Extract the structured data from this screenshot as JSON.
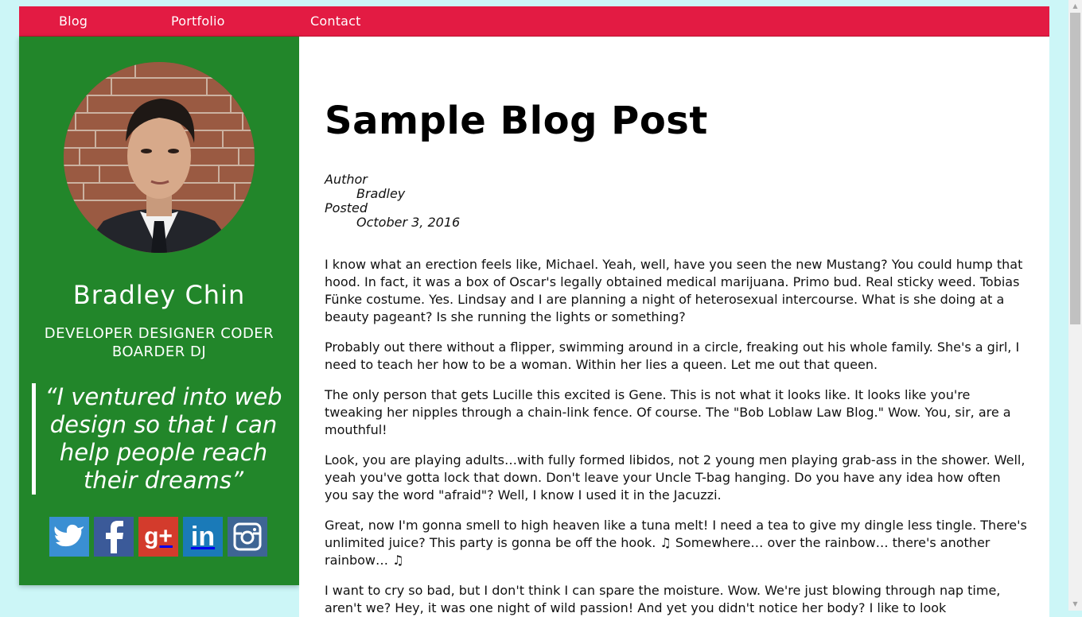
{
  "nav": {
    "items": [
      "Blog",
      "Portfolio",
      "Contact"
    ]
  },
  "profile": {
    "name": "Bradley Chin",
    "roles": "DEVELOPER DESIGNER CODER BOARDER DJ",
    "quote": "“I ventured into web design so that I can help people reach their dreams”",
    "socials": [
      "twitter-icon",
      "facebook-icon",
      "google-plus-icon",
      "linkedin-icon",
      "instagram-icon"
    ]
  },
  "post": {
    "title": "Sample Blog Post",
    "author_label": "Author",
    "author": "Bradley",
    "posted_label": "Posted",
    "posted": "October 3, 2016",
    "paragraphs": [
      "I know what an erection feels like, Michael. Yeah, well, have you seen the new Mustang? You could hump that hood. In fact, it was a box of Oscar's legally obtained medical marijuana. Primo bud. Real sticky weed. Tobias Fünke costume. Yes. Lindsay and I are planning a night of heterosexual intercourse. What is she doing at a beauty pageant? Is she running the lights or something?",
      "Probably out there without a flipper, swimming around in a circle, freaking out his whole family. She's a girl, I need to teach her how to be a woman. Within her lies a queen. Let me out that queen.",
      "The only person that gets Lucille this excited is Gene. This is not what it looks like. It looks like you're tweaking her nipples through a chain-link fence. Of course. The \"Bob Loblaw Law Blog.\" Wow. You, sir, are a mouthful!",
      "Look, you are playing adults…with fully formed libidos, not 2 young men playing grab-ass in the shower. Well, yeah you've gotta lock that down. Don't leave your Uncle T-bag hanging. Do you have any idea how often you say the word \"afraid\"? Well, I know I used it in the Jacuzzi.",
      "Great, now I'm gonna smell to high heaven like a tuna melt! I need a tea to give my dingle less tingle. There's unlimited juice? This party is gonna be off the hook. ♫ Somewhere… over the rainbow… there's another rainbow… ♫",
      "I want to cry so bad, but I don't think I can spare the moisture. Wow. We're just blowing through nap time, aren't we? Hey, it was one night of wild passion! And yet you didn't notice her body? I like to look"
    ]
  },
  "colors": {
    "background": "#ccf6f7",
    "nav": "#e31b43",
    "sidebar": "#22862a"
  }
}
